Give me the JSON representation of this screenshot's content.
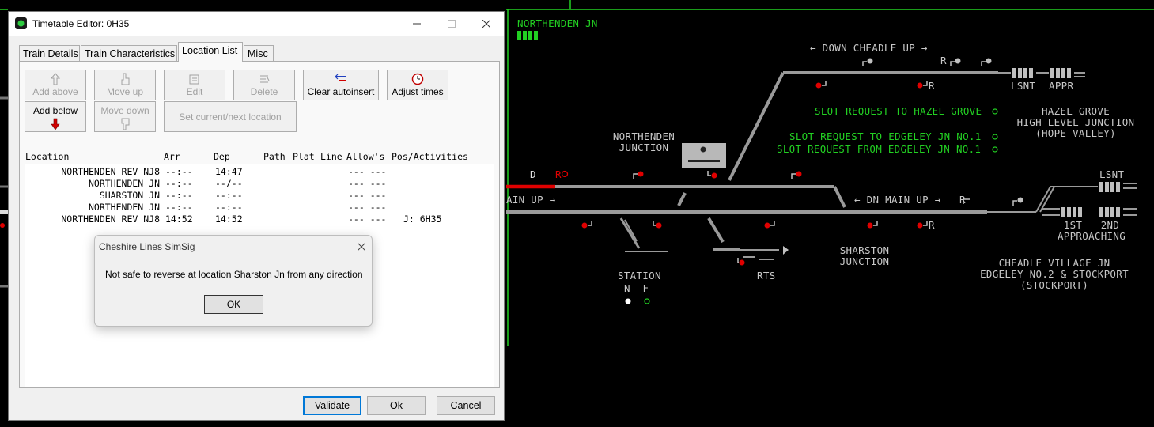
{
  "editor": {
    "title": "Timetable Editor: 0H35",
    "tabs": [
      "Train Details",
      "Train Characteristics",
      "Location List",
      "Misc"
    ],
    "active_tab": "Location List",
    "toolbar": {
      "add_above": "Add above",
      "add_below": "Add below",
      "move_up": "Move up",
      "move_down": "Move down",
      "edit": "Edit",
      "delete": "Delete",
      "set_current": "Set current/next location",
      "clear_autoinsert": "Clear autoinsert",
      "adjust_times": "Adjust times"
    },
    "columns": [
      "Location",
      "Arr",
      "Dep",
      "Path",
      "Plat",
      "Line",
      "Allow's",
      "Pos/Activities"
    ],
    "rows": [
      {
        "location": "NORTHENDEN REV NJ8",
        "arr": "--:--",
        "dep": "14:47",
        "allows": "--- ---",
        "activities": ""
      },
      {
        "location": "NORTHENDEN JN",
        "arr": "--:--",
        "dep": "--/--",
        "allows": "--- ---",
        "activities": ""
      },
      {
        "location": "SHARSTON JN",
        "arr": "--:--",
        "dep": "--:--",
        "allows": "--- ---",
        "activities": ""
      },
      {
        "location": "NORTHENDEN JN",
        "arr": "--:--",
        "dep": "--:--",
        "allows": "--- ---",
        "activities": ""
      },
      {
        "location": "NORTHENDEN REV NJ8",
        "arr": "14:52",
        "dep": "14:52",
        "allows": "--- ---",
        "activities": "J: 6H35"
      }
    ],
    "buttons": {
      "validate": "Validate",
      "ok": "Ok",
      "cancel": "Cancel"
    }
  },
  "dialog": {
    "title": "Cheshire Lines SimSig",
    "message": "Not safe to reverse at location Sharston Jn from any direction",
    "ok": "OK"
  },
  "sim": {
    "area_title": "NORTHENDEN JN",
    "labels": {
      "down_cheadle_up": "← DOWN CHEADLE UP →",
      "lsnt_top": "LSNT",
      "appr_top": "APPR",
      "slot_hazel": "SLOT REQUEST TO HAZEL GROVE",
      "slot_to_edgeley": "SLOT REQUEST TO EDGELEY JN NO.1",
      "slot_from_edgeley": "SLOT REQUEST FROM EDGELEY JN NO.1",
      "hazel_grove": "HAZEL GROVE\nHIGH LEVEL JUNCTION\n(HOPE VALLEY)",
      "northenden_junction": "NORTHENDEN\nJUNCTION",
      "main_up": "AIN UP →",
      "dn_main_up": "← DN MAIN UP →",
      "lsnt_right": "LSNT",
      "first_approaching": "1ST   2ND\nAPPROACHING",
      "station": "STATION",
      "station_nf": "N  F",
      "rts": "RTS",
      "sharston_junction": "SHARSTON\nJUNCTION",
      "cheadle_village": "CHEADLE VILLAGE JN\nEDGELEY NO.2 & STOCKPORT\n(STOCKPORT)",
      "d": "D",
      "r": "R"
    },
    "colors": {
      "track": "#9a9a9a",
      "signal_red": "#e00000",
      "text_green": "#22d022",
      "route_red": "#e00000"
    }
  }
}
